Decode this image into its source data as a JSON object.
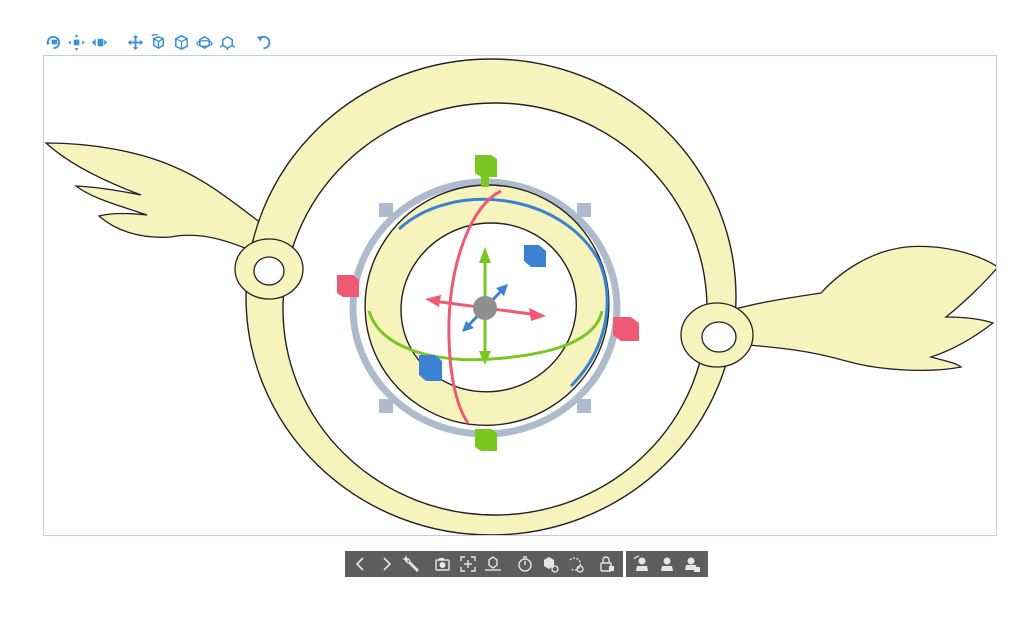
{
  "colors": {
    "accent_blue": "#3c8fd8",
    "ring_fill": "#f6f3bc",
    "ring_stroke": "#222222",
    "frame_border": "#c5c8e6",
    "gizmo_x": "#ee5a73",
    "gizmo_y": "#7ac722",
    "gizmo_z": "#3c82d2",
    "gizmo_scale_frame": "#aebbcc",
    "toolbar_bg": "#5d5d5d",
    "toolbar_icon": "#e6e6e6"
  },
  "top_toolbar": {
    "buttons": [
      {
        "name": "rotate-camera-icon"
      },
      {
        "name": "pan-camera-icon"
      },
      {
        "name": "dolly-camera-icon"
      },
      {
        "name": "move-object-icon"
      },
      {
        "name": "rotate-object-icon"
      },
      {
        "name": "object-front-icon"
      },
      {
        "name": "object-rotate-view-icon"
      },
      {
        "name": "object-settings-icon"
      },
      {
        "name": "undo-camera-icon"
      }
    ]
  },
  "bottom_toolbar": {
    "groups": [
      {
        "buttons": [
          "previous-icon",
          "next-icon",
          "wrench-icon",
          "camera-capture-icon",
          "fit-view-icon",
          "ground-icon",
          "timer-icon",
          "object-list-icon",
          "rotate-reset-icon",
          "lock-icon"
        ]
      },
      {
        "buttons": [
          "pose-icon",
          "pose-alt-icon",
          "pose-preset-icon"
        ]
      }
    ]
  }
}
